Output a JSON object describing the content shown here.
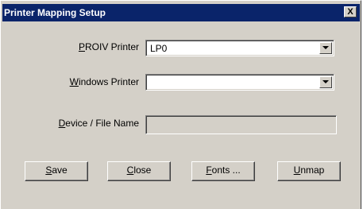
{
  "window": {
    "title": "Printer Mapping Setup",
    "close_glyph": "X"
  },
  "form": {
    "proiv_printer": {
      "label_mnemonic": "P",
      "label_rest": "ROIV Printer",
      "value": "LP0"
    },
    "windows_printer": {
      "label_mnemonic": "W",
      "label_rest": "indows Printer",
      "value": ""
    },
    "device_file_name": {
      "label_mnemonic": "D",
      "label_rest": "evice / File Name",
      "value": ""
    }
  },
  "buttons": {
    "save": {
      "mnemonic": "S",
      "rest": "ave"
    },
    "close": {
      "mnemonic": "C",
      "rest": "lose"
    },
    "fonts": {
      "mnemonic": "F",
      "rest": "onts ..."
    },
    "unmap": {
      "mnemonic": "U",
      "rest": "nmap"
    }
  },
  "colors": {
    "titlebar": "#0a246a",
    "dialog_face": "#d4d0c8"
  }
}
